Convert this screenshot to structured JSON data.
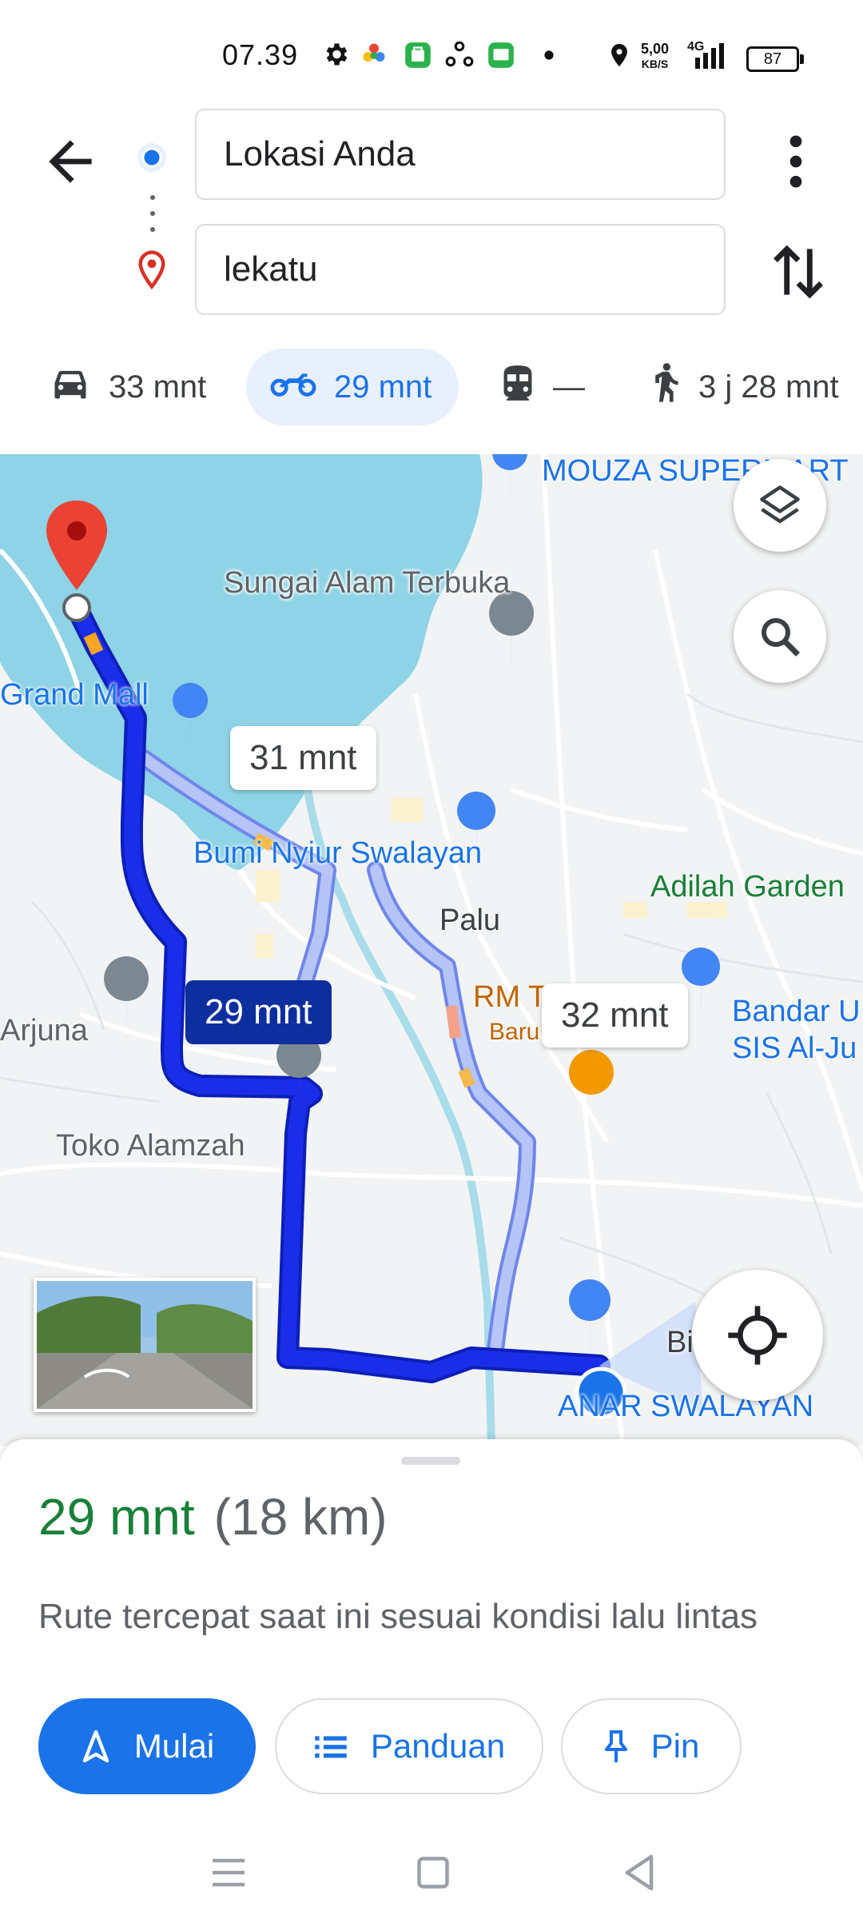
{
  "status_bar": {
    "time": "07.39",
    "net_speed_top": "5,00",
    "net_speed_bottom": "KB/S",
    "network": "4G",
    "battery": "87"
  },
  "search": {
    "origin": "Lokasi Anda",
    "destination": "lekatu"
  },
  "modes": [
    {
      "icon": "car-icon",
      "label": "33 mnt",
      "active": false
    },
    {
      "icon": "motorcycle-icon",
      "label": "29 mnt",
      "active": true
    },
    {
      "icon": "train-icon",
      "label": "—",
      "active": false
    },
    {
      "icon": "walk-icon",
      "label": "3 j 28 mnt",
      "active": false
    }
  ],
  "map": {
    "labels": {
      "mouza": "MOUZA SUPERMART",
      "sungai": "Sungai Alam Terbuka",
      "grand_mall": "Grand Mall",
      "bumi_nyiur": "Bumi Nyiur Swalayan",
      "palu": "Palu",
      "adilah": "Adilah Garden",
      "rm_tovea": "RM Tovea",
      "baru_dilihat": "Baru dilihat",
      "bandar_1": "Bandar U",
      "bandar_2": "SIS Al-Ju",
      "arjuna": "Arjuna",
      "toko_alamzah": "Toko Alamzah",
      "anar": "ANAR SWALAYAN",
      "bi": "Bi"
    },
    "route_bubbles": {
      "alt1": "31 mnt",
      "primary": "29 mnt",
      "alt2": "32 mnt"
    }
  },
  "sheet": {
    "duration": "29 mnt",
    "distance": "(18 km)",
    "description": "Rute tercepat saat ini sesuai kondisi lalu lintas",
    "buttons": {
      "start": "Mulai",
      "steps": "Panduan",
      "pin": "Pin"
    }
  },
  "colors": {
    "accent": "#1a73e8",
    "route_primary": "#1a2de8",
    "route_alt": "#a9b8f5",
    "water": "#8ed3e6",
    "duration_green": "#188038"
  }
}
